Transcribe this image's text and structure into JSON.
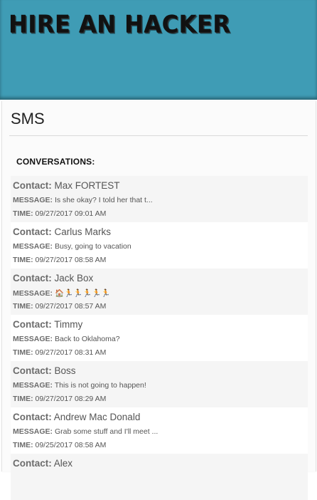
{
  "header": {
    "logo_text": "HIRE AN HACKER"
  },
  "page": {
    "title": "SMS",
    "section_title": "CONVERSATIONS:"
  },
  "labels": {
    "contact": "Contact:",
    "message": "MESSAGE:",
    "time": "TIME:"
  },
  "conversations": [
    {
      "contact": "Max FORTEST",
      "message": "Is she okay? I told her that t...",
      "time": "09/27/2017 09:01 AM"
    },
    {
      "contact": "Carlus Marks",
      "message": "Busy, going to vacation",
      "time": "09/27/2017 08:58 AM"
    },
    {
      "contact": "Jack Box",
      "message": "🏠🏃🏃🏃🏃🏃",
      "time": "09/27/2017 08:57 AM"
    },
    {
      "contact": "Timmy",
      "message": "Back to Oklahoma?",
      "time": "09/27/2017 08:31 AM"
    },
    {
      "contact": "Boss",
      "message": "This is not going to happen!",
      "time": "09/27/2017 08:29 AM"
    },
    {
      "contact": "Andrew Mac Donald",
      "message": "Grab some stuff and I'll meet ...",
      "time": "09/25/2017 08:58 AM"
    },
    {
      "contact": "Alex",
      "message": "",
      "time": ""
    }
  ]
}
